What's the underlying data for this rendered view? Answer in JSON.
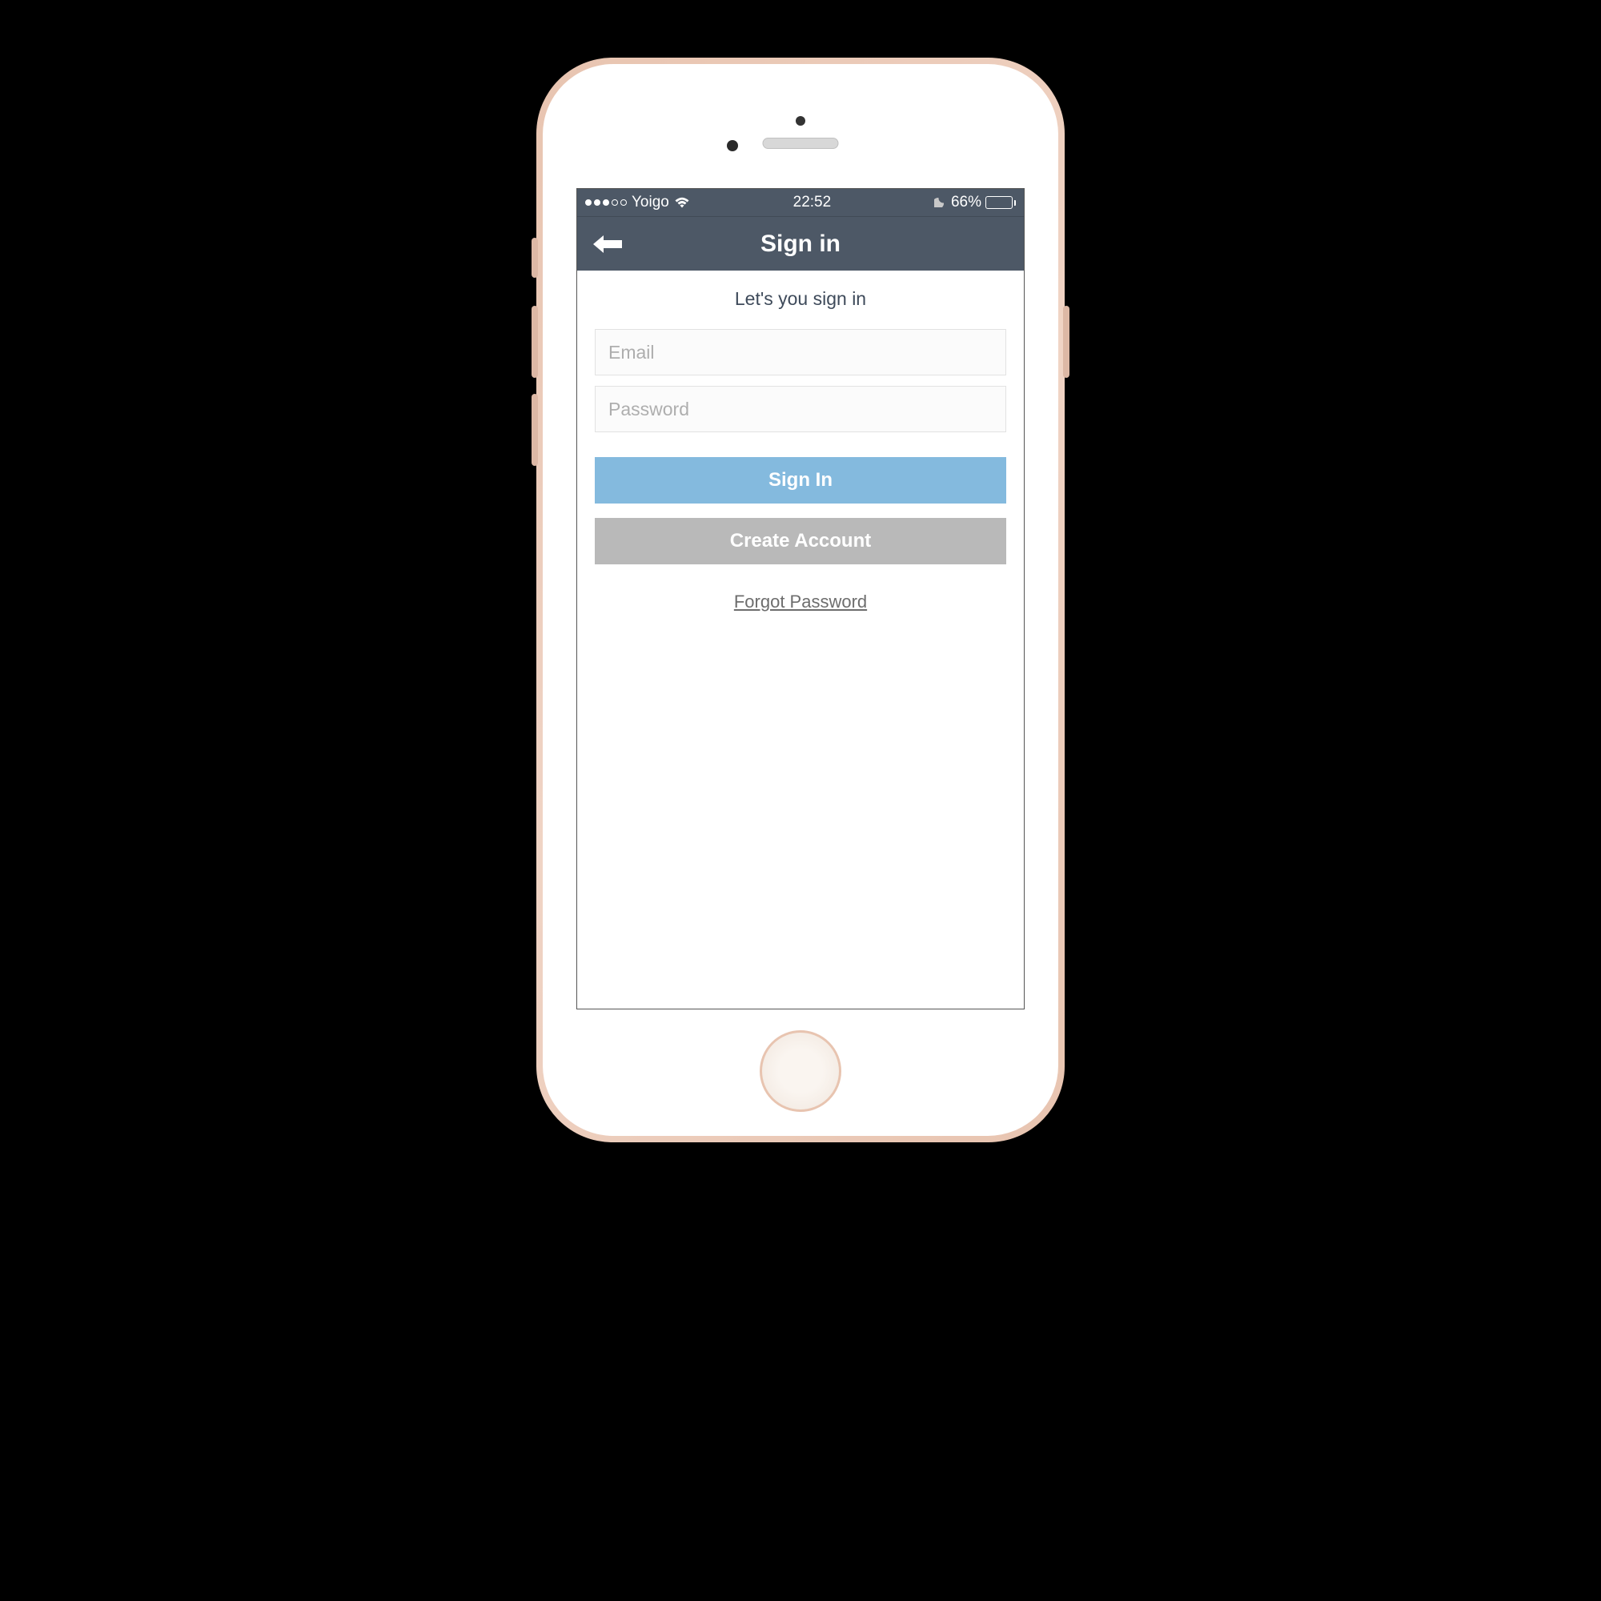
{
  "status_bar": {
    "carrier": "Yoigo",
    "time": "22:52",
    "battery_percent": "66%"
  },
  "nav": {
    "title": "Sign in"
  },
  "form": {
    "subtitle": "Let's you sign in",
    "email_placeholder": "Email",
    "email_value": "",
    "password_placeholder": "Password",
    "password_value": "",
    "signin_label": "Sign In",
    "create_account_label": "Create Account",
    "forgot_label": "Forgot Password"
  }
}
